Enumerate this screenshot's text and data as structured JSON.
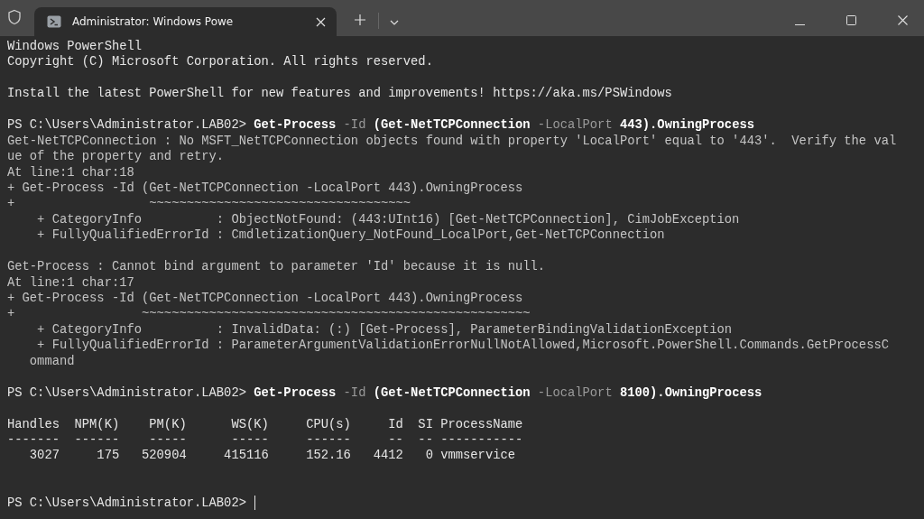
{
  "window": {
    "tab": {
      "title": "Administrator: Windows Powe",
      "selected": true
    }
  },
  "terminal": {
    "lines": [
      {
        "kind": "text",
        "segments": [
          {
            "kind": "plain",
            "text": "Windows PowerShell"
          }
        ]
      },
      {
        "kind": "text",
        "segments": [
          {
            "kind": "plain",
            "text": "Copyright (C) Microsoft Corporation. All rights reserved."
          }
        ]
      },
      {
        "kind": "blank"
      },
      {
        "kind": "text",
        "segments": [
          {
            "kind": "plain",
            "text": "Install the latest PowerShell for new features and improvements! https://aka.ms/PSWindows"
          }
        ]
      },
      {
        "kind": "blank"
      },
      {
        "kind": "text",
        "segments": [
          {
            "kind": "plain",
            "text": "PS C:\\Users\\Administrator.LAB02> "
          },
          {
            "kind": "command",
            "text": "Get-Process"
          },
          {
            "kind": "param",
            "text": " -Id"
          },
          {
            "kind": "command",
            "text": " (Get-NetTCPConnection"
          },
          {
            "kind": "param",
            "text": " -LocalPort"
          },
          {
            "kind": "command",
            "text": " 443).OwningProcess"
          }
        ]
      },
      {
        "kind": "text",
        "segments": [
          {
            "kind": "error",
            "text": "Get-NetTCPConnection : No MSFT_NetTCPConnection objects found with property 'LocalPort' equal to '443'.  Verify the val"
          }
        ]
      },
      {
        "kind": "text",
        "segments": [
          {
            "kind": "error",
            "text": "ue of the property and retry."
          }
        ]
      },
      {
        "kind": "text",
        "segments": [
          {
            "kind": "error",
            "text": "At line:1 char:18"
          }
        ]
      },
      {
        "kind": "text",
        "segments": [
          {
            "kind": "error",
            "text": "+ Get-Process -Id (Get-NetTCPConnection -LocalPort 443).OwningProcess"
          }
        ]
      },
      {
        "kind": "text",
        "segments": [
          {
            "kind": "error",
            "text": "+                  ~~~~~~~~~~~~~~~~~~~~~~~~~~~~~~~~~~~"
          }
        ]
      },
      {
        "kind": "text",
        "segments": [
          {
            "kind": "error",
            "text": "    + CategoryInfo          : ObjectNotFound: (443:UInt16) [Get-NetTCPConnection], CimJobException"
          }
        ]
      },
      {
        "kind": "text",
        "segments": [
          {
            "kind": "error",
            "text": "    + FullyQualifiedErrorId : CmdletizationQuery_NotFound_LocalPort,Get-NetTCPConnection"
          }
        ]
      },
      {
        "kind": "blank"
      },
      {
        "kind": "text",
        "segments": [
          {
            "kind": "error",
            "text": "Get-Process : Cannot bind argument to parameter 'Id' because it is null."
          }
        ]
      },
      {
        "kind": "text",
        "segments": [
          {
            "kind": "error",
            "text": "At line:1 char:17"
          }
        ]
      },
      {
        "kind": "text",
        "segments": [
          {
            "kind": "error",
            "text": "+ Get-Process -Id (Get-NetTCPConnection -LocalPort 443).OwningProcess"
          }
        ]
      },
      {
        "kind": "text",
        "segments": [
          {
            "kind": "error",
            "text": "+                 ~~~~~~~~~~~~~~~~~~~~~~~~~~~~~~~~~~~~~~~~~~~~~~~~~~~~"
          }
        ]
      },
      {
        "kind": "text",
        "segments": [
          {
            "kind": "error",
            "text": "    + CategoryInfo          : InvalidData: (:) [Get-Process], ParameterBindingValidationException"
          }
        ]
      },
      {
        "kind": "text",
        "segments": [
          {
            "kind": "error",
            "text": "    + FullyQualifiedErrorId : ParameterArgumentValidationErrorNullNotAllowed,Microsoft.PowerShell.Commands.GetProcessC"
          }
        ]
      },
      {
        "kind": "text",
        "segments": [
          {
            "kind": "error",
            "text": "   ommand"
          }
        ]
      },
      {
        "kind": "blank"
      },
      {
        "kind": "text",
        "segments": [
          {
            "kind": "plain",
            "text": "PS C:\\Users\\Administrator.LAB02> "
          },
          {
            "kind": "command",
            "text": "Get-Process"
          },
          {
            "kind": "param",
            "text": " -Id"
          },
          {
            "kind": "command",
            "text": " (Get-NetTCPConnection"
          },
          {
            "kind": "param",
            "text": " -LocalPort"
          },
          {
            "kind": "command",
            "text": " 8100).OwningProcess"
          }
        ]
      },
      {
        "kind": "blank"
      },
      {
        "kind": "text",
        "segments": [
          {
            "kind": "plain",
            "text": "Handles  NPM(K)    PM(K)      WS(K)     CPU(s)     Id  SI ProcessName"
          }
        ]
      },
      {
        "kind": "text",
        "segments": [
          {
            "kind": "plain",
            "text": "-------  ------    -----      -----     ------     --  -- -----------"
          }
        ]
      },
      {
        "kind": "text",
        "segments": [
          {
            "kind": "plain",
            "text": "   3027     175   520904     415116     152.16   4412   0 vmmservice"
          }
        ]
      },
      {
        "kind": "blank"
      },
      {
        "kind": "blank"
      },
      {
        "kind": "text",
        "cursor": true,
        "segments": [
          {
            "kind": "plain",
            "text": "PS C:\\Users\\Administrator.LAB02> "
          }
        ]
      }
    ]
  }
}
